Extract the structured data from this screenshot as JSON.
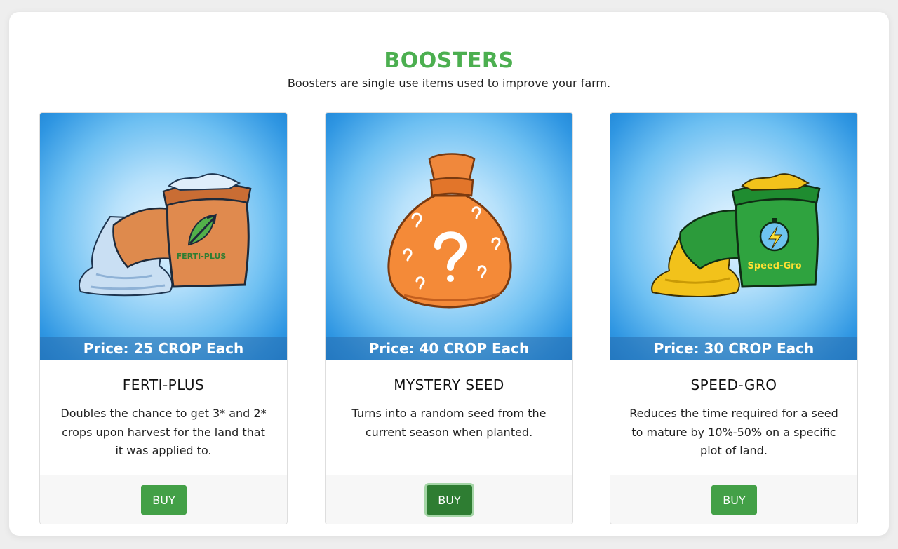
{
  "header": {
    "title": "BOOSTERS",
    "subtitle": "Boosters are single use items used to improve your farm."
  },
  "cards": [
    {
      "name": "FERTI-PLUS",
      "price": "Price: 25 CROP Each",
      "description": "Doubles the chance to get 3* and 2* crops upon harvest for the land that it was applied to.",
      "bag_label": "FERTI-PLUS",
      "buy_label": "BUY",
      "icon": "fertilizer-bag-icon"
    },
    {
      "name": "MYSTERY SEED",
      "price": "Price: 40 CROP Each",
      "description": "Turns into a random seed from the current season when planted.",
      "bag_label": "?",
      "buy_label": "BUY",
      "icon": "mystery-bag-icon"
    },
    {
      "name": "SPEED-GRO",
      "price": "Price: 30 CROP Each",
      "description": "Reduces the time required for a seed to mature by 10%-50% on a specific plot of land.",
      "bag_label": "Speed-Gro",
      "buy_label": "BUY",
      "icon": "speed-bag-icon"
    }
  ],
  "colors": {
    "accent": "#4caf50",
    "buy_button": "#43a047",
    "buy_button_active": "#2e7d32"
  }
}
